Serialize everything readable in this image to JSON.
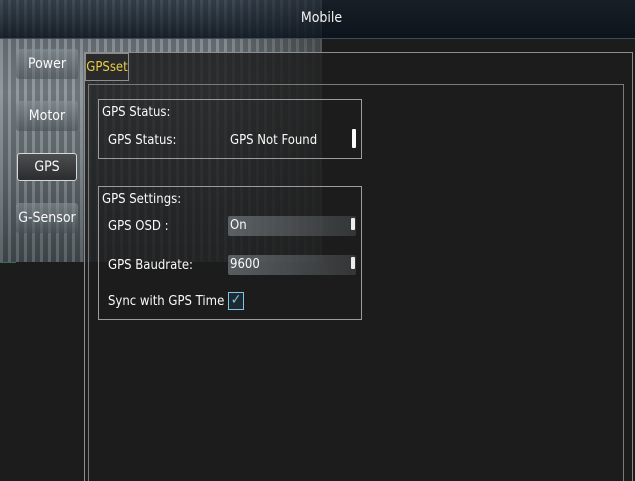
{
  "window": {
    "title": "Mobile"
  },
  "sidebar": {
    "items": [
      {
        "label": "Power"
      },
      {
        "label": "Motor"
      },
      {
        "label": "GPS",
        "selected": true
      },
      {
        "label": "G-Sensor"
      }
    ]
  },
  "tab": {
    "label": "GPSset"
  },
  "gps_status": {
    "group_title": "GPS Status:",
    "label": "GPS Status:",
    "value": "GPS Not Found"
  },
  "gps_settings": {
    "group_title": "GPS Settings:",
    "osd": {
      "label": "GPS OSD :",
      "value": "On"
    },
    "baudrate": {
      "label": "GPS Baudrate:",
      "value": "9600"
    },
    "sync": {
      "label": "Sync with GPS Time :",
      "checked": true,
      "check_glyph": "✓"
    }
  },
  "colors": {
    "tab_text": "#e8cf46",
    "checkbox_accent": "#7cc7e4",
    "panel_border": "#8d8d8d"
  }
}
